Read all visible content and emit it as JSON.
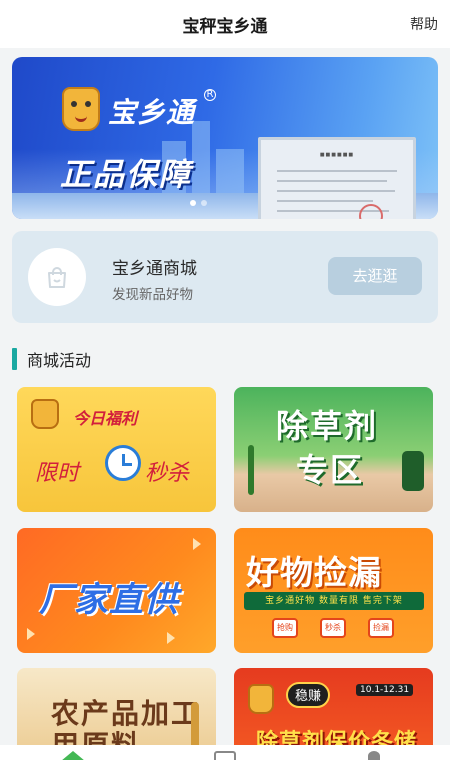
{
  "header": {
    "title": "宝秤宝乡通",
    "help_label": "帮助"
  },
  "banner": {
    "logo_text": "宝乡通",
    "registered_mark": "R",
    "slogan": "正品保障",
    "active_slide": 1,
    "slide_count": 2
  },
  "mall": {
    "name": "宝乡通商城",
    "description": "发现新品好物",
    "button_label": "去逛逛"
  },
  "section": {
    "title": "商城活动"
  },
  "tiles": {
    "t1": {
      "title": "今日福利",
      "left_text": "限时",
      "right_text": "秒杀"
    },
    "t2": {
      "line1": "除草剂",
      "line2": "专区"
    },
    "t3": {
      "title": "厂家直供"
    },
    "t4": {
      "title": "好物捡漏",
      "strip": "宝乡通好物  数量有限  售完下架",
      "pills": [
        "抢购",
        "秒杀",
        "捡漏"
      ]
    },
    "t5": {
      "title": "农产品加工用原料"
    },
    "t6": {
      "badge": "稳赚",
      "date": "10.1-12.31",
      "title": "除草剂保价冬储"
    }
  },
  "colors": {
    "accent": "#1aa8a1",
    "mall_card": "#dde9f1",
    "mall_button": "#b8cfdf",
    "home_tab": "#43b854"
  },
  "tabbar": {
    "icons": [
      "home-icon",
      "category-icon",
      "profile-icon"
    ]
  }
}
